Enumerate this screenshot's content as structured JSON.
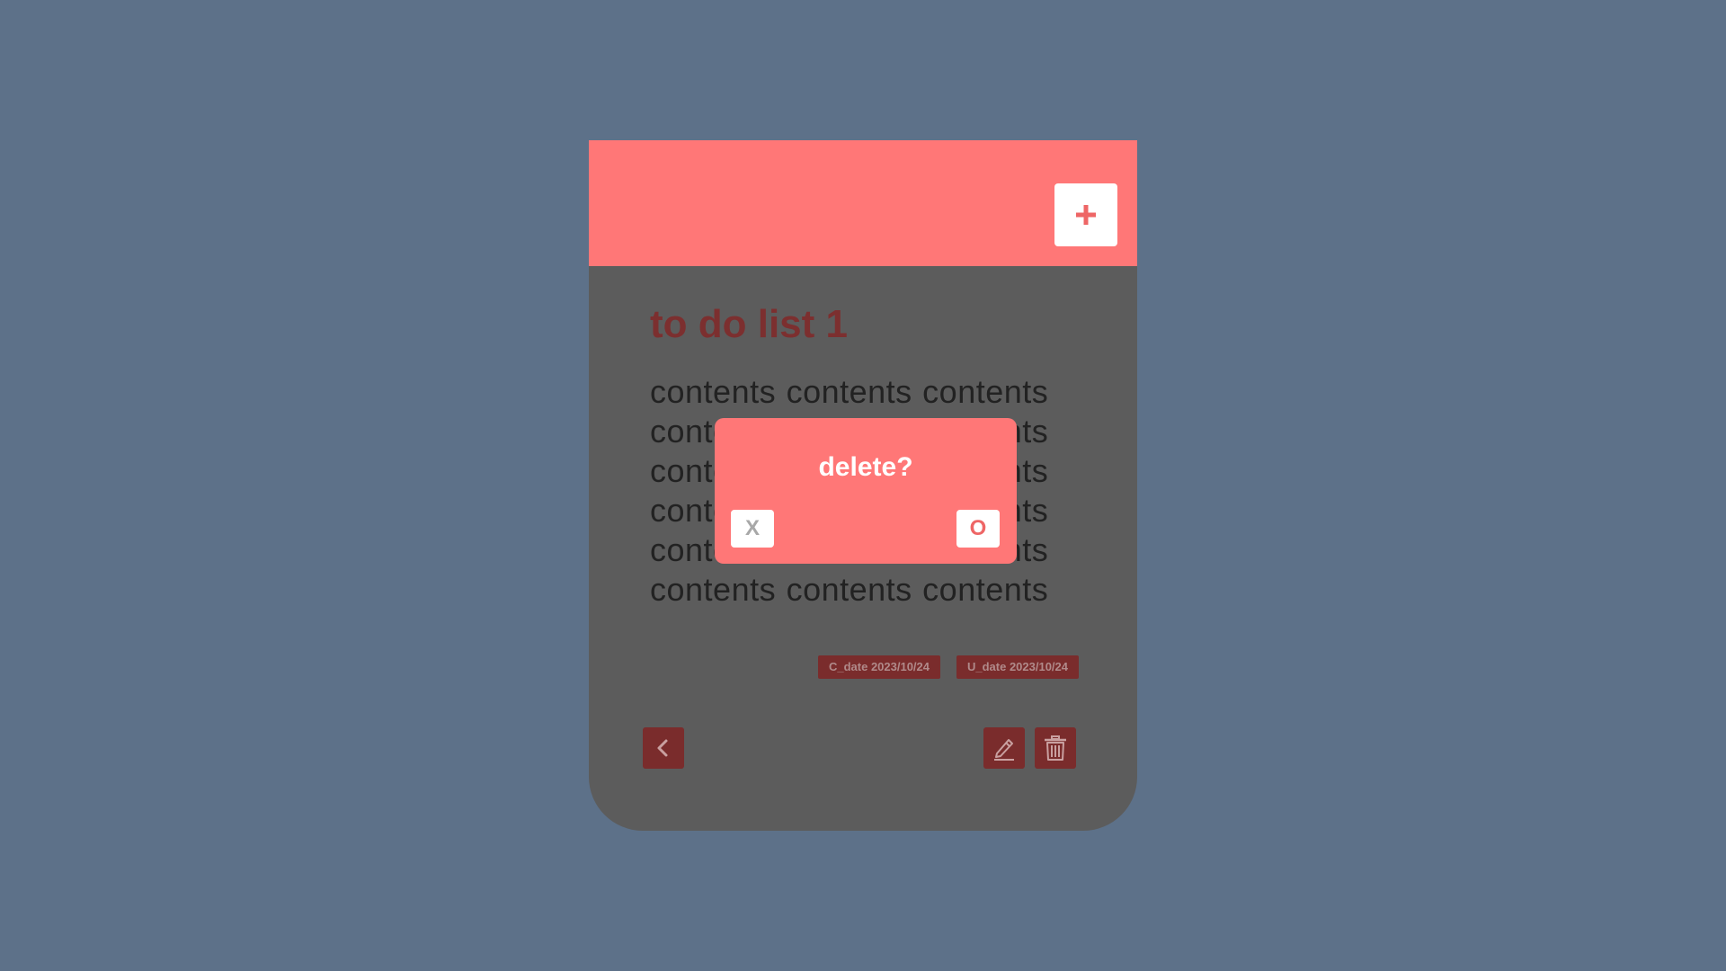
{
  "header": {
    "add_icon": "plus-icon",
    "color": "#ff7777"
  },
  "todo": {
    "title": "to do list 1",
    "content": "contents contents contents contents contents contents contents contents contents contents contents contents contents contents contents contents contents contents",
    "created_date": "C_date 2023/10/24",
    "updated_date": "U_date 2023/10/24"
  },
  "toolbar": {
    "back_icon": "chevron-left-icon",
    "edit_icon": "pencil-icon",
    "delete_icon": "trash-icon"
  },
  "dialog": {
    "title": "delete?",
    "cancel_label": "X",
    "confirm_label": "O"
  },
  "colors": {
    "background": "#5d7189",
    "accent": "#ff7777",
    "card": "#5c5c5c",
    "dark_accent": "#7a2c2c"
  }
}
